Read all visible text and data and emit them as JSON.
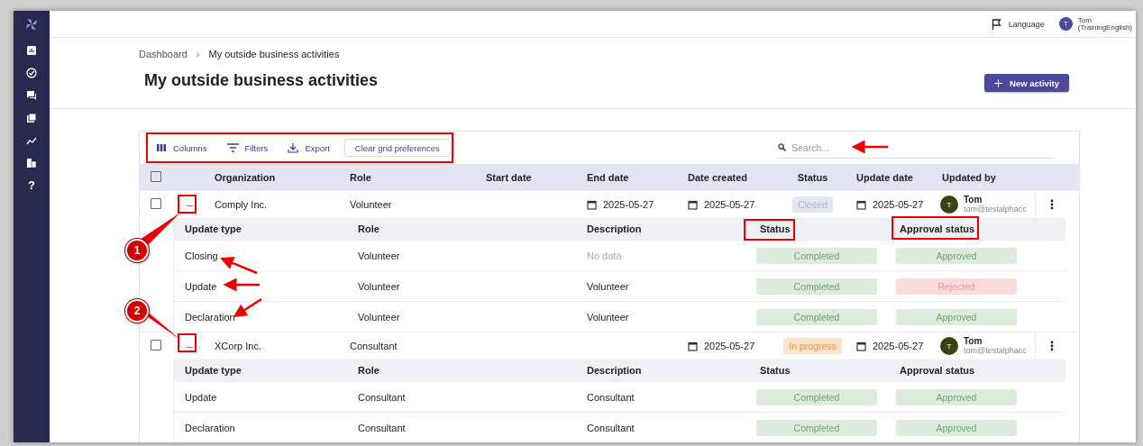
{
  "sidebar": {
    "help_label": "?"
  },
  "top_bar": {
    "language": "Language",
    "user": {
      "initial": "T",
      "name": "Tom",
      "account": "(TrainingEnglish)"
    }
  },
  "breadcrumb_separator": "›",
  "breadcrumb": [
    {
      "label": "Dashboard",
      "current": false
    },
    {
      "label": "My outside business activities",
      "current": true
    }
  ],
  "title": "My outside business activities",
  "new_button": "New activity",
  "toolbar": {
    "buttons": [
      {
        "kind": "columns",
        "label": "Columns"
      },
      {
        "kind": "filters",
        "label": "Filters"
      },
      {
        "kind": "export",
        "label": "Export"
      }
    ],
    "clear_button": "Clear grid preferences",
    "search": {
      "placeholder": "Search..."
    }
  },
  "table": {
    "select_all_checked": false,
    "columns": [
      "Organization",
      "Role",
      "Start date",
      "End date",
      "Date created",
      "Status",
      "Update date",
      "Updated by"
    ],
    "rows": [
      {
        "checked": false,
        "expanded": true,
        "organization": "Comply Inc.",
        "role": "Volunteer",
        "end_date": "2025-05-27",
        "date_created": "2025-05-27",
        "status": {
          "text": "Closed",
          "kind": "closed"
        },
        "update_date": "2025-05-27",
        "updated_by": {
          "initial": "T",
          "name": "Tom",
          "email": "tom@testalphacc"
        },
        "details": {
          "columns": [
            "Update type",
            "Role",
            "Description",
            "Status",
            "Approval status"
          ],
          "rows": [
            {
              "update_type": "Closing",
              "role": "Volunteer",
              "description": "No data",
              "description_muted": true,
              "status": {
                "text": "Completed",
                "kind": "success"
              },
              "approval": {
                "text": "Approved",
                "kind": "success"
              }
            },
            {
              "update_type": "Update",
              "role": "Volunteer",
              "description": "Volunteer",
              "description_muted": false,
              "status": {
                "text": "Completed",
                "kind": "success"
              },
              "approval": {
                "text": "Rejected",
                "kind": "danger"
              }
            },
            {
              "update_type": "Declaration",
              "role": "Volunteer",
              "description": "Volunteer",
              "description_muted": false,
              "status": {
                "text": "Completed",
                "kind": "success"
              },
              "approval": {
                "text": "Approved",
                "kind": "success"
              }
            }
          ]
        }
      },
      {
        "checked": false,
        "expanded": true,
        "organization": "XCorp Inc.",
        "role": "Consultant",
        "date_created": "2025-05-27",
        "status": {
          "text": "In progress",
          "kind": "progress"
        },
        "update_date": "2025-05-27",
        "updated_by": {
          "initial": "T",
          "name": "Tom",
          "email": "tom@testalphacc"
        },
        "details": {
          "columns": [
            "Update type",
            "Role",
            "Description",
            "Status",
            "Approval status"
          ],
          "rows": [
            {
              "update_type": "Update",
              "role": "Consultant",
              "description": "Consultant",
              "description_muted": false,
              "status": {
                "text": "Completed",
                "kind": "success"
              },
              "approval": {
                "text": "Approved",
                "kind": "success"
              }
            },
            {
              "update_type": "Declaration",
              "role": "Consultant",
              "description": "Consultant",
              "description_muted": false,
              "status": {
                "text": "Completed",
                "kind": "success"
              },
              "approval": {
                "text": "Approved",
                "kind": "success"
              }
            }
          ]
        }
      }
    ]
  },
  "annotations": {
    "callouts": [
      {
        "label": "1"
      },
      {
        "label": "2"
      }
    ]
  }
}
